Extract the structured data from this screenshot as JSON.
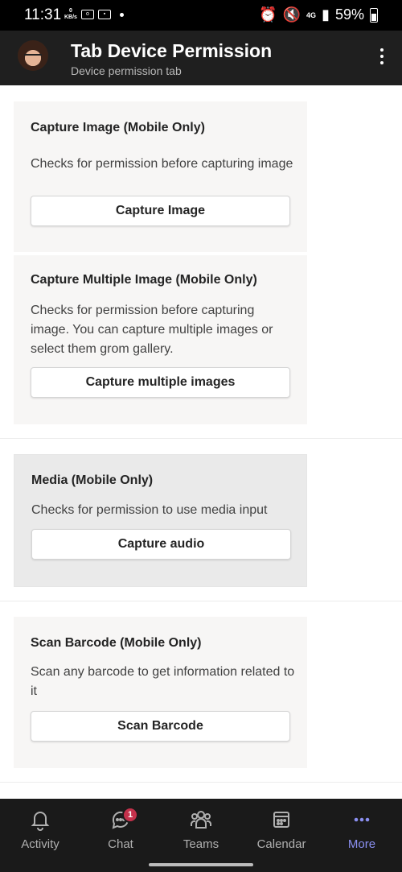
{
  "status": {
    "time": "11:31",
    "kb_value": "0",
    "kb_unit": "KB/s",
    "network": "4G",
    "battery": "59%"
  },
  "header": {
    "title": "Tab Device Permission",
    "subtitle": "Device permission tab"
  },
  "cards": [
    {
      "title": "Capture Image (Mobile Only)",
      "description": "Checks for permission before capturing image",
      "button": "Capture Image"
    },
    {
      "title": "Capture Multiple Image (Mobile Only)",
      "description": "Checks for permission before capturing image. You can capture multiple images or select them grom gallery.",
      "button": "Capture multiple images"
    },
    {
      "title": "Media (Mobile Only)",
      "description": "Checks for permission to use media input",
      "button": "Capture audio"
    },
    {
      "title": "Scan Barcode (Mobile Only)",
      "description": "Scan any barcode to get information related to it",
      "button": "Scan Barcode"
    }
  ],
  "nav": {
    "items": [
      {
        "label": "Activity",
        "icon": "bell-icon"
      },
      {
        "label": "Chat",
        "icon": "chat-icon",
        "badge": "1"
      },
      {
        "label": "Teams",
        "icon": "teams-icon"
      },
      {
        "label": "Calendar",
        "icon": "calendar-icon"
      },
      {
        "label": "More",
        "icon": "more-icon",
        "active": true
      }
    ]
  },
  "colors": {
    "active_nav": "#8a8ff0",
    "badge": "#c4314b",
    "header_bg": "#1f1f1f",
    "card_bg": "#f7f6f5"
  }
}
